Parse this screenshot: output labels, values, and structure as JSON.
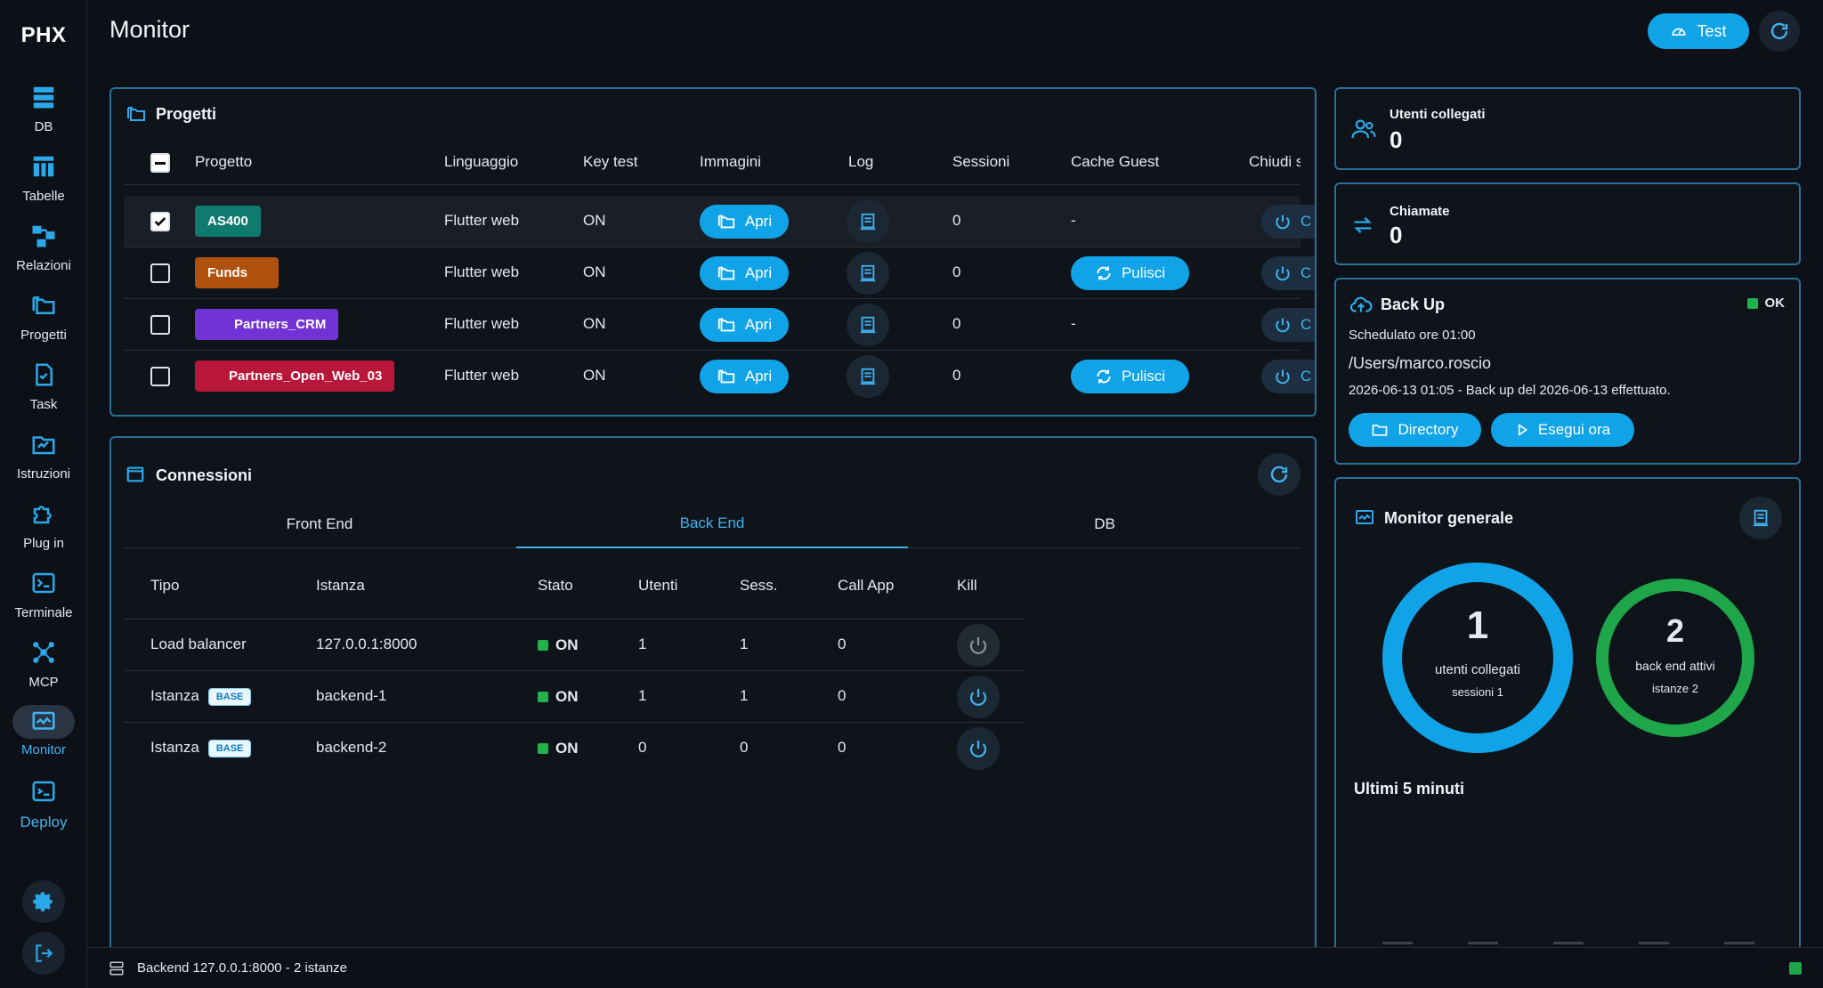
{
  "app": {
    "logo": "PHX",
    "page_title": "Monitor"
  },
  "sidebar": {
    "items": [
      {
        "label": "DB",
        "icon": "db-icon"
      },
      {
        "label": "Tabelle",
        "icon": "table-icon"
      },
      {
        "label": "Relazioni",
        "icon": "relations-icon"
      },
      {
        "label": "Progetti",
        "icon": "folders-icon"
      },
      {
        "label": "Task",
        "icon": "task-icon"
      },
      {
        "label": "Istruzioni",
        "icon": "instructions-icon"
      },
      {
        "label": "Plug in",
        "icon": "puzzle-icon"
      },
      {
        "label": "Terminale",
        "icon": "terminal-icon"
      },
      {
        "label": "MCP",
        "icon": "mcp-icon"
      },
      {
        "label": "Monitor",
        "icon": "monitor-icon",
        "active": true
      },
      {
        "label": "Deploy",
        "icon": "deploy-icon"
      }
    ]
  },
  "header": {
    "test_label": "Test"
  },
  "progetti": {
    "title": "Progetti",
    "columns": [
      "Progetto",
      "Linguaggio",
      "Key test",
      "Immagini",
      "Log",
      "Sessioni",
      "Cache Guest",
      "Chiudi s"
    ],
    "rows": [
      {
        "name": "AS400",
        "color": "#0f7a6e",
        "lang": "Flutter web",
        "key": "ON",
        "img": "Apri",
        "sessions": "0",
        "cache": "-",
        "checked": true
      },
      {
        "name": "Funds",
        "color": "#b0520f",
        "lang": "Flutter web",
        "key": "ON",
        "img": "Apri",
        "sessions": "0",
        "cache": "Pulisci",
        "checked": false
      },
      {
        "name": "Partners_CRM",
        "color": "#7132d6",
        "lang": "Flutter web",
        "key": "ON",
        "img": "Apri",
        "sessions": "0",
        "cache": "-",
        "checked": false
      },
      {
        "name": "Partners_Open_Web_03",
        "color": "#b8173a",
        "lang": "Flutter web",
        "key": "ON",
        "img": "Apri",
        "sessions": "0",
        "cache": "Pulisci",
        "checked": false
      }
    ],
    "chiudi_label": "C"
  },
  "connessioni": {
    "title": "Connessioni",
    "tabs": [
      "Front End",
      "Back End",
      "DB"
    ],
    "active_tab": "Back End",
    "columns": [
      "Tipo",
      "Istanza",
      "Stato",
      "Utenti",
      "Sess.",
      "Call App",
      "Kill"
    ],
    "rows": [
      {
        "tipo": "Load balancer",
        "badge": "",
        "istanza": "127.0.0.1:8000",
        "stato": "ON",
        "utenti": "1",
        "sess": "1",
        "call": "0"
      },
      {
        "tipo": "Istanza",
        "badge": "BASE",
        "istanza": "backend-1",
        "stato": "ON",
        "utenti": "1",
        "sess": "1",
        "call": "0"
      },
      {
        "tipo": "Istanza",
        "badge": "BASE",
        "istanza": "backend-2",
        "stato": "ON",
        "utenti": "0",
        "sess": "0",
        "call": "0"
      }
    ]
  },
  "utenti": {
    "label": "Utenti collegati",
    "value": "0"
  },
  "chiamate": {
    "label": "Chiamate",
    "value": "0"
  },
  "backup": {
    "title": "Back Up",
    "status": "OK",
    "schedule": "Schedulato ore 01:00",
    "path": "/Users/marco.roscio",
    "last": "2026-06-13 01:05 - Back up del 2026-06-13 effettuato.",
    "directory_label": "Directory",
    "run_label": "Esegui ora"
  },
  "monitor_generale": {
    "title": "Monitor generale",
    "users": {
      "value": "1",
      "label": "utenti collegati",
      "sub": "sessioni 1",
      "color": "#11a3e8"
    },
    "backends": {
      "value": "2",
      "label": "back end attivi",
      "sub": "istanze 2",
      "color": "#1fa64a"
    },
    "last_minutes": "Ultimi 5 minuti"
  },
  "statusbar": {
    "text": "Backend 127.0.0.1:8000 - 2 istanze"
  }
}
